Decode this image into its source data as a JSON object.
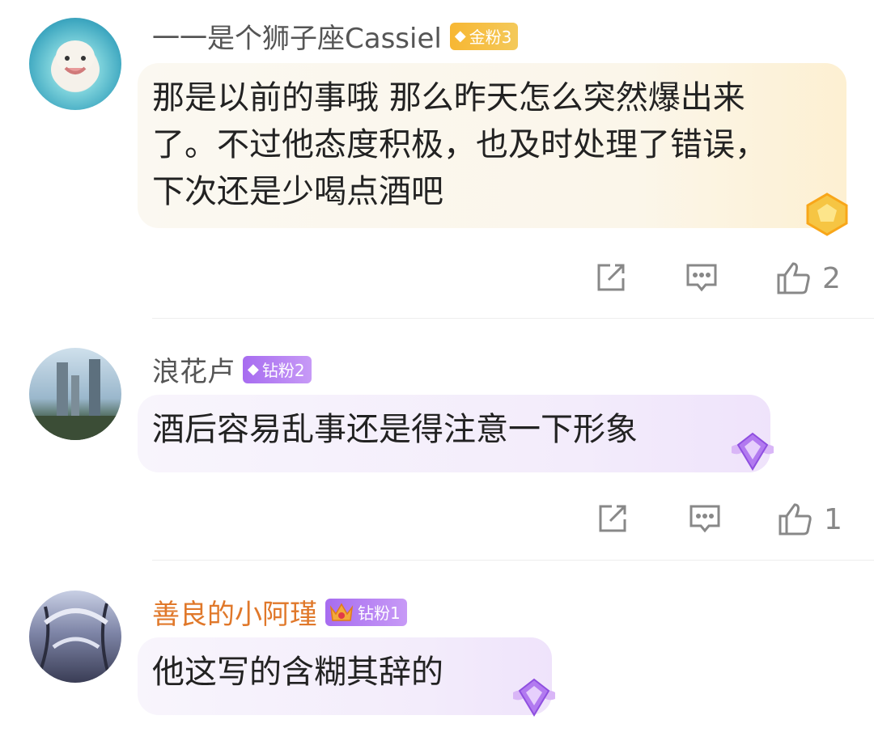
{
  "comments": [
    {
      "username": "一一是个狮子座Cassiel",
      "badge": {
        "label": "金粉3",
        "type": "gold"
      },
      "text": "那是以前的事哦 那么昨天怎么突然爆出来了。不过他态度积极，也及时处理了错误，下次还是少喝点酒吧",
      "likes": "2"
    },
    {
      "username": "浪花卢",
      "badge": {
        "label": "钻粉2",
        "type": "diamond"
      },
      "text": "酒后容易乱事还是得注意一下形象",
      "likes": "1"
    },
    {
      "username": "善良的小阿瑾",
      "badge": {
        "label": "钻粉1",
        "type": "diamond"
      },
      "text": "他这写的含糊其辞的",
      "likes": ""
    }
  ],
  "colors": {
    "username_highlight": "#e0782a",
    "gold_badge": "#f7b733",
    "diamond_badge": "#a76cf0"
  },
  "icons": [
    "share-icon",
    "reply-icon",
    "like-icon",
    "crown-icon",
    "diamond-icon"
  ]
}
